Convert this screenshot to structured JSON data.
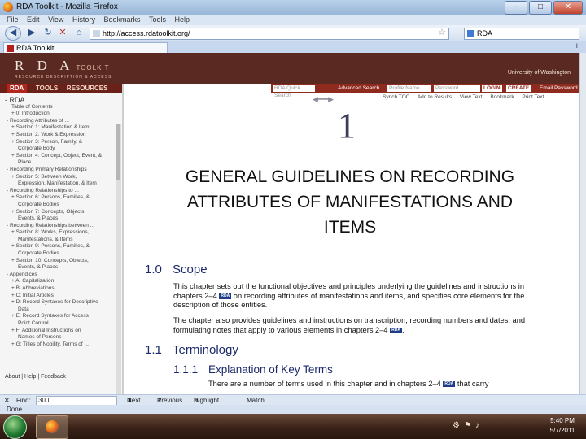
{
  "window": {
    "title": "RDA Toolkit - Mozilla Firefox",
    "controls": [
      "–",
      "□",
      "✕"
    ]
  },
  "menu": [
    "File",
    "Edit",
    "View",
    "History",
    "Bookmarks",
    "Tools",
    "Help"
  ],
  "nav": {
    "url": "http://access.rdatoolkit.org/",
    "search_placeholder": "RDA"
  },
  "tab": {
    "label": "RDA Toolkit",
    "new_tab": "+"
  },
  "site": {
    "logo_main": "R D A",
    "logo_word": "TOOLKIT",
    "logo_sub": "RESOURCE DESCRIPTION & ACCESS",
    "institution": "University of Washington",
    "nav_tabs": [
      "RDA",
      "TOOLS",
      "RESOURCES"
    ],
    "search_placeholder": "RDA Quick Search",
    "advanced_search": "Advanced Search",
    "username_placeholder": "Profile Name",
    "password_placeholder": "Password",
    "login": "LOGIN",
    "create": "CREATE",
    "email_password": "Email Password",
    "links": [
      "Synch TOC",
      "Add to Results",
      "View Text",
      "Bookmark",
      "Print Text"
    ]
  },
  "toc": {
    "heading": "- RDA",
    "items": [
      "Table of Contents",
      "+ 0: Introduction",
      "- Recording Attributes of ...",
      "+ Section 1: Manifestation & Item",
      "+ Section 2: Work & Expression",
      "+ Section 3: Person, Family, &",
      "  Corporate Body",
      "+ Section 4: Concept, Object, Event, &",
      "  Place",
      "- Recording Primary Relationships",
      "+ Section 5: Between Work,",
      "  Expression, Manifestation, & Item",
      "- Recording Relationships to ...",
      "+ Section 6: Persons, Families, &",
      "  Corporate Bodies",
      "+ Section 7: Concepts, Objects,",
      "  Events, & Places",
      "- Recording Relationships between ...",
      "+ Section 8: Works, Expressions,",
      "  Manifestations, & Items",
      "+ Section 9: Persons, Families, &",
      "  Corporate Bodies",
      "+ Section 10: Concepts, Objects,",
      "  Events, & Places",
      "- Appendices",
      "+ A: Capitalization",
      "+ B: Abbreviations",
      "+ C: Initial Articles",
      "+ D: Record Syntaxes for Descriptive",
      "  Data",
      "+ E: Record Syntaxes for Access",
      "  Point Control",
      "+ F: Additional Instructions on",
      "  Names of Persons",
      "+ G: Titles of Nobility, Terms of ..."
    ],
    "footer_links": [
      "About",
      "Help",
      "Feedback"
    ]
  },
  "doc": {
    "chapter_number": "1",
    "chapter_title": "GENERAL GUIDELINES ON RECORDING ATTRIBUTES OF MANIFESTATIONS AND ITEMS",
    "sections": [
      {
        "num": "1.0",
        "title": "Scope"
      },
      {
        "num": "1.1",
        "title": "Terminology"
      },
      {
        "num": "1.1.1",
        "title": "Explanation of Key Terms"
      }
    ],
    "para1a": "This chapter sets out the functional objectives and principles underlying the guidelines and instructions in chapters 2–4",
    "para1b": "on recording attributes of manifestations and items, and specifies core elements for the description of those entities.",
    "para2a": "The chapter also provides guidelines and instructions on transcription, recording numbers and dates, and formulating notes that apply to various elements in chapters 2–4",
    "para2b": ".",
    "para3a": "There are a number of terms used in this chapter and in chapters 2–4",
    "para3b": "that carry",
    "rda_badge": "RDA"
  },
  "find": {
    "close": "✕",
    "label": "Find:",
    "value": "300",
    "next": "Next",
    "previous": "Previous",
    "highlight": "Highlight all",
    "match_case": "Match case"
  },
  "status": "Done",
  "taskbar": {
    "time": "5:40 PM",
    "date": "5/7/2011"
  },
  "colors": {
    "banner": "#5a2a22",
    "nav_tab_bg": "#6a2218",
    "heading_blue": "#1c2a6b",
    "rda_badge": "#1f3c8a"
  }
}
